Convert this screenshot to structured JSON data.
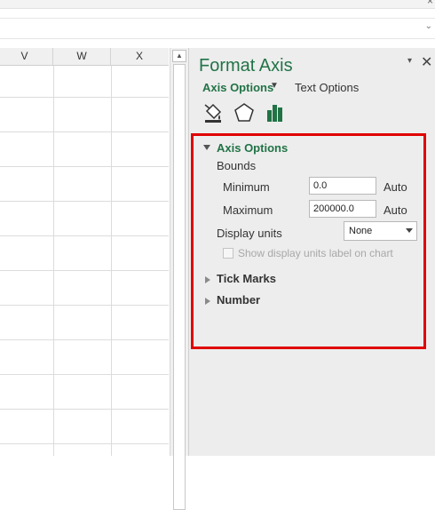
{
  "window": {
    "close_glyph": "×",
    "expand_glyph": "⌄"
  },
  "sheet": {
    "columns": [
      "V",
      "W",
      "X"
    ]
  },
  "pane": {
    "title": "Format Axis",
    "tabs": [
      "Axis Options",
      "Text Options"
    ],
    "icons": [
      "fill-line-icon",
      "effects-icon",
      "axis-options-icon"
    ],
    "close_glyph": "✕",
    "dropdown_glyph": "▾"
  },
  "axis_options": {
    "label": "Axis Options",
    "bounds_label": "Bounds",
    "minimum": {
      "label": "Minimum",
      "value": "0.0",
      "mode": "Auto"
    },
    "maximum": {
      "label": "Maximum",
      "value": "200000.0",
      "mode": "Auto"
    },
    "display_units": {
      "label": "Display units",
      "value": "None"
    },
    "show_units_label": {
      "label": "Show display units label on chart",
      "checked": false
    }
  },
  "sections": {
    "tick_marks": "Tick Marks",
    "number": "Number"
  },
  "colors": {
    "accent": "#217346",
    "highlight": "#e00000"
  }
}
